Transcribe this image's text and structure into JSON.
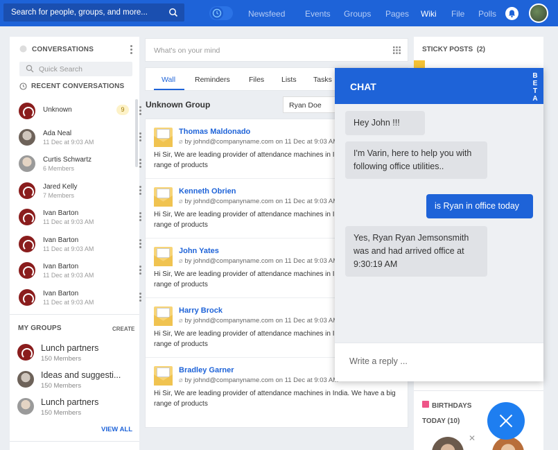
{
  "topbar": {
    "search_placeholder": "Search for people, groups, and more...",
    "nav": [
      "Newsfeed",
      "Events",
      "Groups",
      "Pages",
      "Wiki",
      "File",
      "Polls"
    ],
    "active_nav": "Wiki"
  },
  "conversations": {
    "title": "CONVERSATIONS",
    "quick_search": "Quick Search",
    "recent_title": "RECENT CONVERSATIONS",
    "items": [
      {
        "name": "Unknown",
        "sub": "",
        "badge": "9"
      },
      {
        "name": "Ada Neal",
        "sub": "11 Dec at 9:03 AM"
      },
      {
        "name": "Curtis Schwartz",
        "sub": "6 Members"
      },
      {
        "name": "Jared Kelly",
        "sub": "7 Members"
      },
      {
        "name": "Ivan Barton",
        "sub": "11 Dec at 9:03 AM"
      },
      {
        "name": "Ivan Barton",
        "sub": "11 Dec at 9:03 AM"
      },
      {
        "name": "Ivan Barton",
        "sub": "11 Dec at 9:03 AM"
      },
      {
        "name": "Ivan Barton",
        "sub": "11 Dec at 9:03 AM"
      }
    ]
  },
  "groups": {
    "title": "MY GROUPS",
    "create": "CREATE",
    "view_all": "VIEW ALL",
    "items": [
      {
        "name": "Lunch partners",
        "sub": "150 Members"
      },
      {
        "name": "Ideas and suggesti...",
        "sub": "150 Members"
      },
      {
        "name": "Lunch partners",
        "sub": "150 Members"
      }
    ]
  },
  "composer": {
    "placeholder": "What's on your mind"
  },
  "tabs": [
    "Wall",
    "Reminders",
    "Files",
    "Lists",
    "Tasks"
  ],
  "group_title": "Unknown Group",
  "filter_value": "Ryan Doe",
  "feed": [
    {
      "sender": "Thomas Maldonado",
      "by": "by johnd@companyname.com on 11 Dec at 9:03 AM",
      "msg": "Hi Sir, We are leading provider of attendance machines in India. We have a big range of products"
    },
    {
      "sender": "Kenneth Obrien",
      "by": "by johnd@companyname.com on 11 Dec at 9:03 AM",
      "msg": "Hi Sir, We are leading provider of attendance machines in India. We have a big range of products"
    },
    {
      "sender": "John Yates",
      "by": "by johnd@companyname.com on 11 Dec at 9:03 AM",
      "msg": "Hi Sir, We are leading provider of attendance machines in India. We have a big range of products"
    },
    {
      "sender": "Harry Brock",
      "by": "by johnd@companyname.com on 11 Dec at 9:03 AM",
      "msg": "Hi Sir, We are leading provider of attendance machines in India. We have a big range of products"
    },
    {
      "sender": "Bradley Garner",
      "by": "by johnd@companyname.com on 11 Dec at 9:03 AM",
      "msg": "Hi Sir, We are leading provider of attendance machines in India. We have a big range of products"
    }
  ],
  "sticky": {
    "title": "STICKY POSTS",
    "count": "(2)"
  },
  "birthdays": {
    "title": "BIRTHDAYS",
    "today": "TODAY (10)"
  },
  "chat": {
    "title": "CHAT",
    "beta": [
      "B",
      "E",
      "T",
      "A"
    ],
    "messages": [
      {
        "dir": "in",
        "text": "Hey John !!!"
      },
      {
        "dir": "in",
        "text": "I'm Varin, here to help you with following office utilities.."
      },
      {
        "dir": "out",
        "text": "is Ryan in office today"
      },
      {
        "dir": "in",
        "text": "Yes, Ryan Ryan Jemsonsmith was and had arrived office at 9:30:19 AM"
      }
    ],
    "reply_placeholder": "Write a reply ..."
  }
}
